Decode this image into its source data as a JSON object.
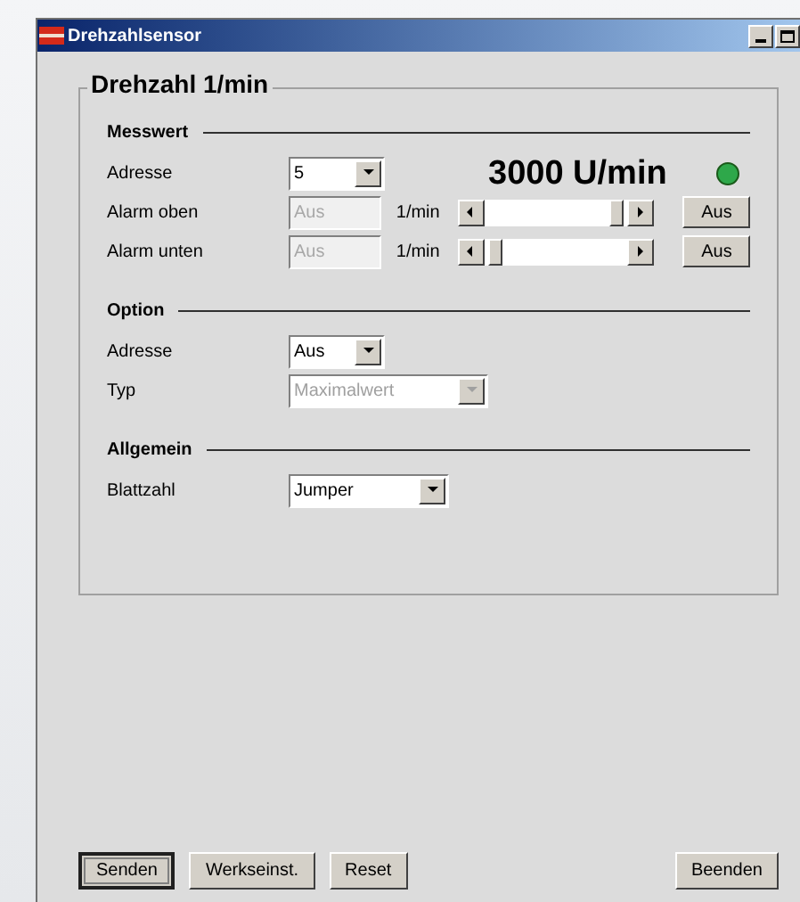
{
  "window": {
    "title": "Drehzahlsensor"
  },
  "group": {
    "title": "Drehzahl 1/min"
  },
  "sections": [
    {
      "title": "Messwert",
      "rows": [
        {
          "kind": "reading",
          "label": "Adresse",
          "value": "5",
          "reading": "3000 U/min",
          "indicator_on": true
        },
        {
          "kind": "alarm",
          "label": "Alarm oben",
          "value": "Aus",
          "disabled": true,
          "unit": "1/min",
          "button": "Aus"
        },
        {
          "kind": "alarm",
          "label": "Alarm unten",
          "value": "Aus",
          "disabled": true,
          "unit": "1/min",
          "button": "Aus"
        }
      ]
    },
    {
      "title": "Option",
      "rows": [
        {
          "kind": "select",
          "label": "Adresse",
          "value": "Aus",
          "disabled": false
        },
        {
          "kind": "select",
          "label": "Typ",
          "value": "Maximalwert",
          "disabled": true
        }
      ]
    },
    {
      "title": "Allgemein",
      "rows": [
        {
          "kind": "select",
          "label": "Blattzahl",
          "value": "Jumper",
          "disabled": false
        }
      ]
    }
  ],
  "buttons": [
    {
      "label": "Senden",
      "default": true
    },
    {
      "label": "Werkseinst.",
      "default": false
    },
    {
      "label": "Reset",
      "default": false
    },
    {
      "label": "Beenden",
      "default": false
    }
  ]
}
